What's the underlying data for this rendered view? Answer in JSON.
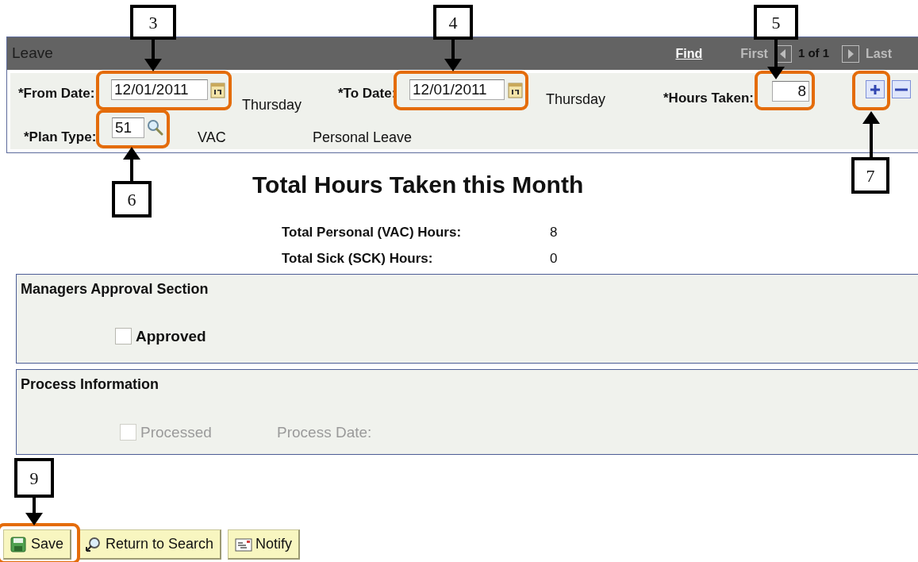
{
  "panel": {
    "title": "Leave",
    "find_link": "Find",
    "nav_first": "First",
    "counter": "1 of 1",
    "nav_last": "Last"
  },
  "fields": {
    "from_date": {
      "label": "*From Date:",
      "value": "12/01/2011",
      "weekday": "Thursday"
    },
    "to_date": {
      "label": "*To Date:",
      "value": "12/01/2011",
      "weekday": "Thursday"
    },
    "hours_taken": {
      "label": "*Hours Taken:",
      "value": "8"
    },
    "plan_type": {
      "label": "*Plan Type:",
      "value": "51",
      "code": "VAC",
      "description": "Personal Leave"
    }
  },
  "summary": {
    "title": "Total Hours Taken this Month",
    "rows": [
      {
        "label": "Total Personal (VAC) Hours:",
        "value": "8"
      },
      {
        "label": "Total Sick (SCK) Hours:",
        "value": "0"
      }
    ]
  },
  "approval_section": {
    "title": "Managers Approval Section",
    "checkbox": {
      "label": "Approved",
      "checked": false,
      "disabled": false
    }
  },
  "process_section": {
    "title": "Process Information",
    "checkbox": {
      "label": "Processed",
      "checked": false,
      "disabled": true
    },
    "date_label": "Process Date:"
  },
  "buttons": [
    {
      "label": "Save",
      "kind": "save"
    },
    {
      "label": "Return to Search",
      "kind": "search"
    },
    {
      "label": "Notify",
      "kind": "notify"
    }
  ],
  "callouts": [
    {
      "number": "3"
    },
    {
      "number": "4"
    },
    {
      "number": "5"
    },
    {
      "number": "7"
    },
    {
      "number": "6"
    },
    {
      "number": "9"
    }
  ]
}
